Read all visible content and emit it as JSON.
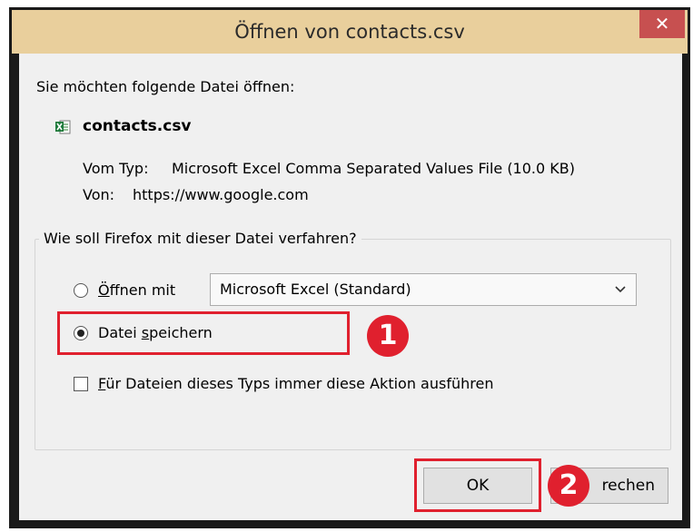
{
  "dialog": {
    "title": "Öffnen von contacts.csv",
    "close_glyph": "✕",
    "prompt": "Sie möchten folgende Datei öffnen:",
    "file": {
      "icon": "excel-csv-file-icon",
      "name": "contacts.csv",
      "type_label": "Vom Typ:",
      "type_value": "Microsoft Excel Comma Separated Values File (10.0 KB)",
      "from_label": "Von:",
      "from_value": "https://www.google.com"
    },
    "action_group": {
      "legend": "Wie soll Firefox mit dieser Datei verfahren?",
      "open_with": {
        "accesskey": "Ö",
        "rest": "ffnen mit",
        "selected": false
      },
      "open_with_app": "Microsoft Excel (Standard)",
      "save_file": {
        "pre": "Datei ",
        "accesskey": "s",
        "rest": "peichern",
        "selected": true
      },
      "always": {
        "accesskey": "F",
        "rest": "ür Dateien dieses Typs immer diese Aktion ausführen",
        "checked": false
      }
    },
    "buttons": {
      "ok": "OK",
      "cancel_visible": "rechen"
    }
  },
  "annotations": {
    "step1": "1",
    "step2": "2",
    "highlight_color": "#e0202e"
  }
}
